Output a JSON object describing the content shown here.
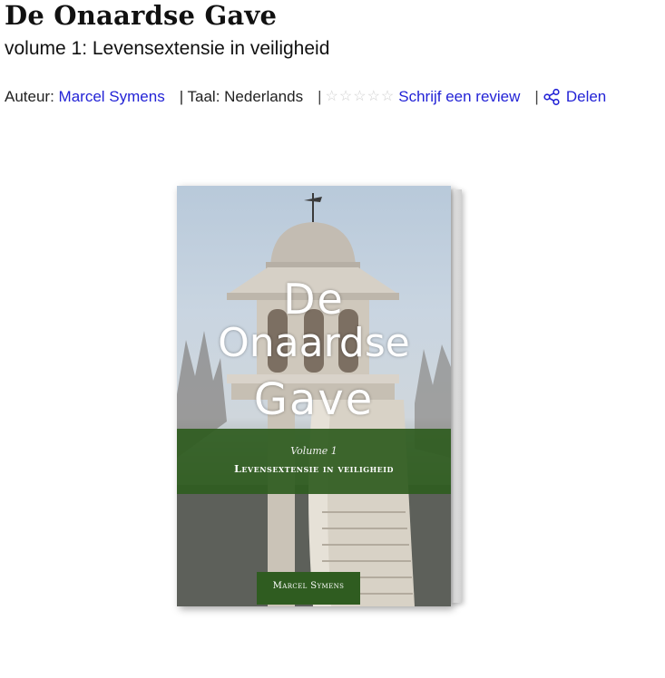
{
  "product": {
    "title": "De Onaardse Gave",
    "subtitle": "volume 1: Levensextensie in veiligheid"
  },
  "meta": {
    "author_label": "Auteur:",
    "author_name": "Marcel Symens",
    "language_text": "| Taal: Nederlands",
    "sep": "|",
    "rating_stars": 5,
    "rating_value": 0,
    "review_label": "Schrijf een review",
    "share_label": "Delen",
    "share_icon": "share-icon",
    "star_icon": "star-outline-icon"
  },
  "cover": {
    "title_line1": "De",
    "title_line2": "Onaardse",
    "title_line3": "Gave",
    "volume": "Volume 1",
    "subtitle": "Levensextensie in veiligheid",
    "author": "Marcel Symens"
  },
  "colors": {
    "link": "#2323d6",
    "cover_green": "#2f5c20"
  }
}
